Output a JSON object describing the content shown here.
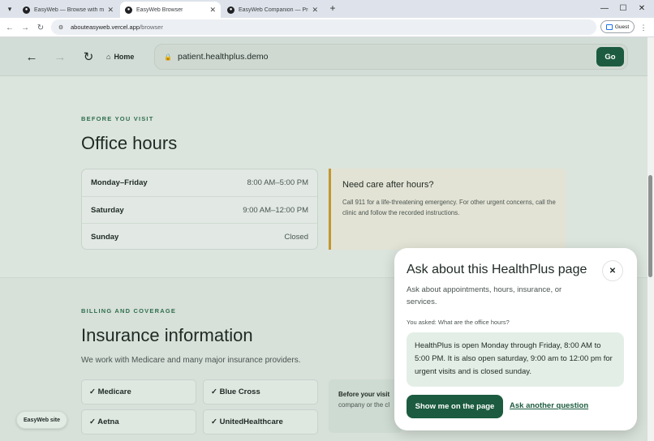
{
  "browser": {
    "tabs": [
      {
        "title": "EasyWeb — Browse with more…",
        "active": false
      },
      {
        "title": "EasyWeb Browser",
        "active": true
      },
      {
        "title": "EasyWeb Companion — Protot…",
        "active": false
      }
    ],
    "address": {
      "host": "abouteasyweb.vercel.app",
      "path": "/browser"
    },
    "profile_label": "Guest",
    "icons": {
      "tab_search": "▾",
      "favicon": "●",
      "tab_close": "✕",
      "new_tab": "+",
      "minimize": "—",
      "maximize": "☐",
      "close": "✕",
      "back": "←",
      "forward": "→",
      "reload": "↻",
      "site_info": "⚙",
      "menu": "⋮"
    }
  },
  "demo_bar": {
    "back": "←",
    "forward": "→",
    "reload": "↻",
    "home_icon": "⌂",
    "home_label": "Home",
    "lock_icon": "🔒",
    "url": "patient.healthplus.demo",
    "go_label": "Go"
  },
  "office_hours": {
    "eyebrow": "BEFORE YOU VISIT",
    "title": "Office hours",
    "rows": [
      {
        "day": "Monday–Friday",
        "time": "8:00 AM–5:00 PM"
      },
      {
        "day": "Saturday",
        "time": "9:00 AM–12:00 PM"
      },
      {
        "day": "Sunday",
        "time": "Closed"
      }
    ],
    "after_hours_title": "Need care after hours?",
    "after_hours_body": "Call 911 for a life-threatening emergency. For other urgent concerns, call the clinic and follow the recorded instructions."
  },
  "billing": {
    "eyebrow": "BILLING AND COVERAGE",
    "title": "Insurance information",
    "intro": "We work with Medicare and many major insurance providers.",
    "providers": [
      "✓ Medicare",
      "✓ Blue Cross",
      "✓ Aetna",
      "✓ UnitedHealthcare"
    ],
    "visit_card_title": "Before your visit",
    "visit_card_body": "company or the cl"
  },
  "easyweb_pill": "EasyWeb site",
  "dialog": {
    "title": "Ask about this HealthPlus page",
    "close_icon": "✕",
    "subtitle": "Ask about appointments, hours, insurance, or services.",
    "asked": "You asked: What are the office hours?",
    "answer": "HealthPlus is open Monday through Friday, 8:00 AM to 5:00 PM. It is also open saturday, 9:00 am to 12:00 pm for urgent visits and is closed sunday.",
    "show_button": "Show me on the page",
    "another_link": "Ask another question"
  },
  "colors": {
    "accent": "#1c5b3f",
    "eyebrow": "#2f6e4c",
    "after_hours_border": "#c3962f",
    "answer_bg": "#e3efe6"
  }
}
